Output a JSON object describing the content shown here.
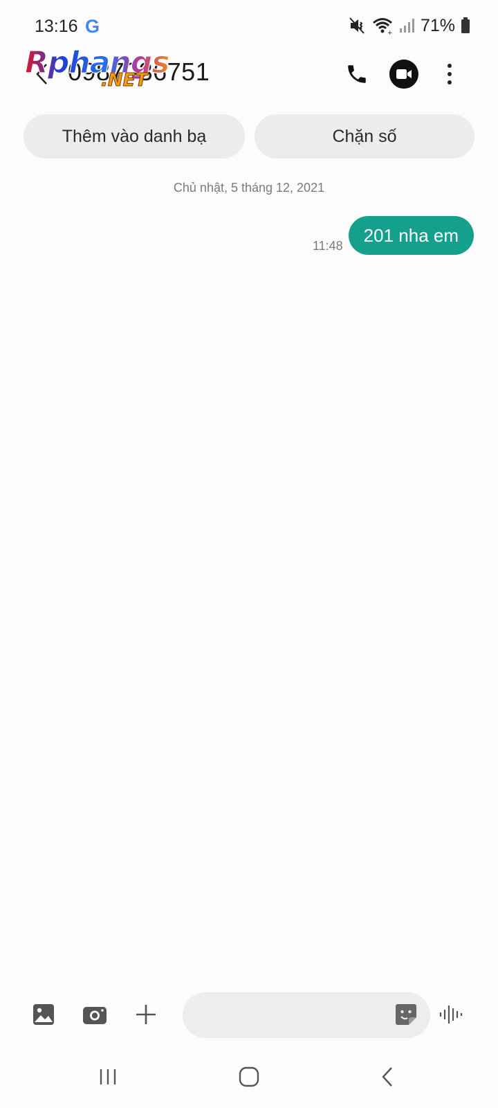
{
  "status_bar": {
    "time": "13:16",
    "g_label": "G",
    "battery": "71%"
  },
  "header": {
    "contact": "0987036751",
    "watermark_main": "Rphangs",
    "watermark_sub": ".NET"
  },
  "actions": {
    "add_contact": "Thêm vào danh bạ",
    "block": "Chặn số"
  },
  "conversation": {
    "date": "Chủ nhật, 5 tháng 12, 2021",
    "messages": [
      {
        "time": "11:48",
        "text": "201 nha em",
        "direction": "outgoing"
      }
    ]
  },
  "compose": {
    "value": "",
    "placeholder": ""
  },
  "colors": {
    "bubble": "#15a08e",
    "chip": "#ececec",
    "background": "#fcfcfc"
  }
}
